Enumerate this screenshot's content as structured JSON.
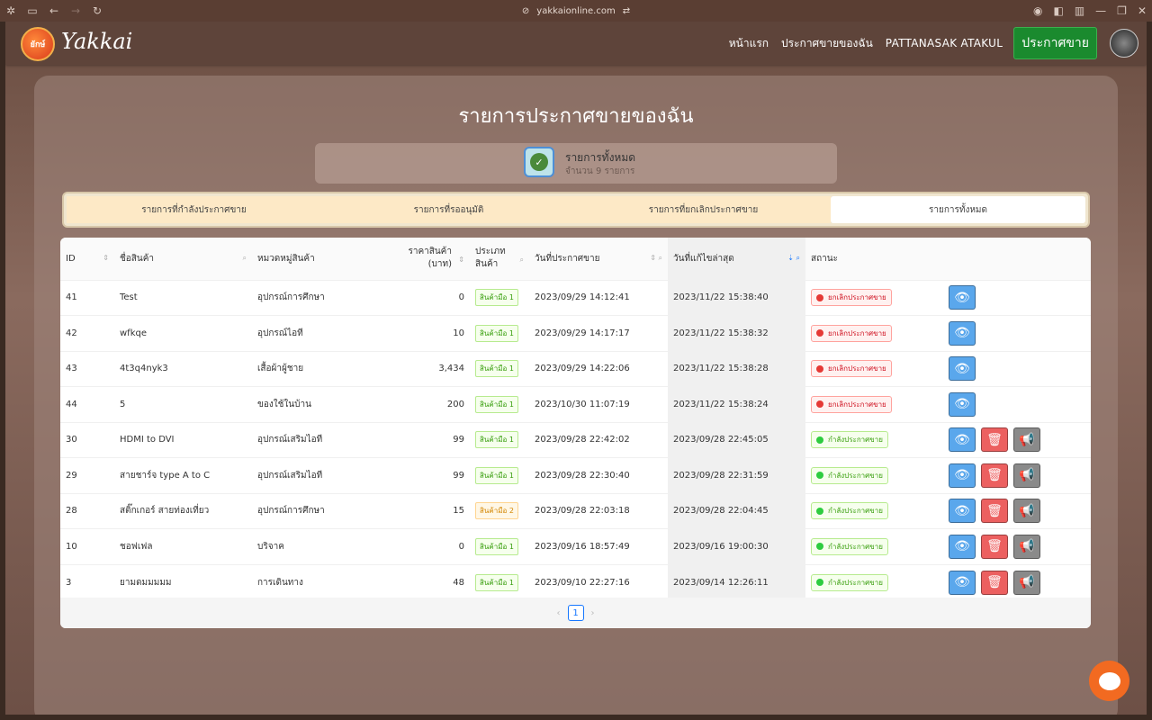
{
  "browser": {
    "url": "yakkaionline.com"
  },
  "nav": {
    "brand": "Yakkai",
    "home": "หน้าแรก",
    "my_listings": "ประกาศขายของฉัน",
    "user": "PATTANASAK ATAKUL",
    "sell": "ประกาศขาย"
  },
  "page": {
    "title": "รายการประกาศขายของฉัน"
  },
  "summary": {
    "title": "รายการทั้งหมด",
    "count": "จำนวน 9 รายการ"
  },
  "tabs": [
    "รายการที่กำลังประกาศขาย",
    "รายการที่รออนุมัติ",
    "รายการที่ยกเลิกประกาศขาย",
    "รายการทั้งหมด"
  ],
  "table": {
    "headers": {
      "id": "ID",
      "name": "ชื่อสินค้า",
      "category": "หมวดหมู่สินค้า",
      "price": "ราคาสินค้า (บาท)",
      "type": "ประเภทสินค้า",
      "created": "วันที่ประกาศขาย",
      "updated": "วันที่แก้ไขล่าสุด",
      "status": "สถานะ"
    },
    "rows": [
      {
        "id": "41",
        "name": "Test",
        "category": "อุปกรณ์การศึกษา",
        "price": "0",
        "type": "สินค้ามือ 1",
        "created": "2023/09/29 14:12:41",
        "updated": "2023/11/22 15:38:40",
        "status": "ยกเลิกประกาศขาย"
      },
      {
        "id": "42",
        "name": "wfkqe",
        "category": "อุปกรณ์ไอที",
        "price": "10",
        "type": "สินค้ามือ 1",
        "created": "2023/09/29 14:17:17",
        "updated": "2023/11/22 15:38:32",
        "status": "ยกเลิกประกาศขาย"
      },
      {
        "id": "43",
        "name": "4t3q4nyk3",
        "category": "เสื้อผ้าผู้ชาย",
        "price": "3,434",
        "type": "สินค้ามือ 1",
        "created": "2023/09/29 14:22:06",
        "updated": "2023/11/22 15:38:28",
        "status": "ยกเลิกประกาศขาย"
      },
      {
        "id": "44",
        "name": "5",
        "category": "ของใช้ในบ้าน",
        "price": "200",
        "type": "สินค้ามือ 1",
        "created": "2023/10/30 11:07:19",
        "updated": "2023/11/22 15:38:24",
        "status": "ยกเลิกประกาศขาย"
      },
      {
        "id": "30",
        "name": "HDMI to DVI",
        "category": "อุปกรณ์เสริมไอที",
        "price": "99",
        "type": "สินค้ามือ 1",
        "created": "2023/09/28 22:42:02",
        "updated": "2023/09/28 22:45:05",
        "status": "กำลังประกาศขาย"
      },
      {
        "id": "29",
        "name": "สายชาร์จ type A to C",
        "category": "อุปกรณ์เสริมไอที",
        "price": "99",
        "type": "สินค้ามือ 1",
        "created": "2023/09/28 22:30:40",
        "updated": "2023/09/28 22:31:59",
        "status": "กำลังประกาศขาย"
      },
      {
        "id": "28",
        "name": "สติ๊กเกอร์ สายท่องเที่ยว",
        "category": "อุปกรณ์การศึกษา",
        "price": "15",
        "type": "สินค้ามือ 2",
        "created": "2023/09/28 22:03:18",
        "updated": "2023/09/28 22:04:45",
        "status": "กำลังประกาศขาย"
      },
      {
        "id": "10",
        "name": "ชอฟเฟล",
        "category": "บริจาค",
        "price": "0",
        "type": "สินค้ามือ 1",
        "created": "2023/09/16 18:57:49",
        "updated": "2023/09/16 19:00:30",
        "status": "กำลังประกาศขาย"
      },
      {
        "id": "3",
        "name": "ยามดมมมมม",
        "category": "การเดินทาง",
        "price": "48",
        "type": "สินค้ามือ 1",
        "created": "2023/09/10 22:27:16",
        "updated": "2023/09/14 12:26:11",
        "status": "กำลังประกาศขาย"
      }
    ]
  },
  "pagination": {
    "current": "1"
  }
}
